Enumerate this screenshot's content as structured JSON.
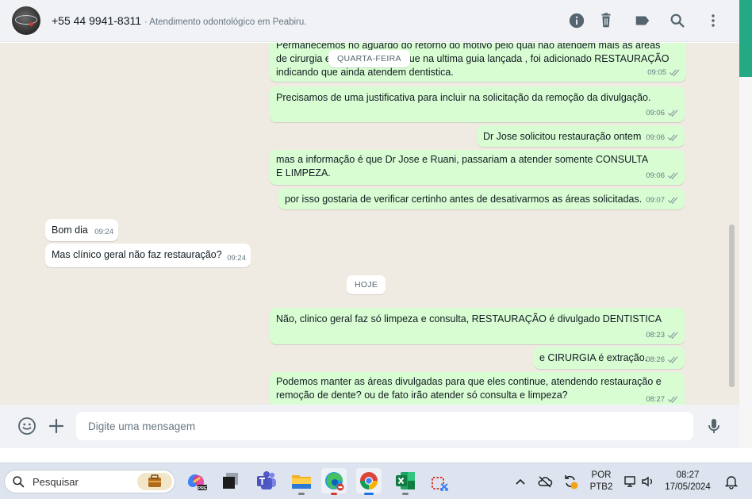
{
  "header": {
    "title": "+55 44 9941-8311",
    "subtitle": "· Atendimento odontológico em Peabiru.",
    "icons": [
      "info-icon",
      "trash-icon",
      "label-icon",
      "search-icon",
      "more-icon"
    ]
  },
  "messages": [
    {
      "type": "out",
      "line1": "Permanecemos no aguardo do retorno do motivo pelo qual não atendem mais as áreas",
      "line2": "de cirurgia e",
      "line2b": "que na ultima guia lançada , foi adicionado RESTAURAÇÃO",
      "line3": "indicando que ainda atendem dentistica.",
      "time": "09:05"
    },
    {
      "type": "out",
      "text": "Precisamos de uma justificativa para incluir na solicitação da remoção da divulgação.",
      "time": "09:06"
    },
    {
      "type": "out",
      "text": "Dr Jose solicitou restauração ontem",
      "time": "09:06"
    },
    {
      "type": "out",
      "text": "mas a informação é que Dr Jose e Ruani, passariam a atender somente CONSULTA E LIMPEZA.",
      "time": "09:06"
    },
    {
      "type": "out",
      "text": "por isso gostaria de verificar certinho antes de desativarmos as áreas solicitadas.",
      "time": "09:07"
    },
    {
      "type": "in",
      "text": "Bom dia",
      "time": "09:24"
    },
    {
      "type": "in",
      "text": "Mas clínico geral não faz restauração?",
      "time": "09:24"
    },
    {
      "type": "out",
      "text": "Não, clinico geral faz só limpeza e consulta, RESTAURAÇÃO é divulgado DENTISTICA",
      "time": "08:23"
    },
    {
      "type": "out",
      "text": "e CIRURGIA é extração.",
      "time": "08:26"
    },
    {
      "type": "out",
      "text": "Podemos manter as áreas divulgadas para que eles continue, atendendo restauração e remoção de dente? ou de fato irão atender só consulta e limpeza?",
      "time": "08:27"
    }
  ],
  "date_chips": {
    "previous": "QUARTA-FEIRA",
    "today": "HOJE"
  },
  "composer": {
    "placeholder": "Digite uma mensagem"
  },
  "taskbar": {
    "search_label": "Pesquisar",
    "apps": [
      "copilot-icon",
      "task-view-icon",
      "teams-icon",
      "file-explorer-icon",
      "edge-icon",
      "chrome-icon",
      "excel-icon",
      "snipping-tool-icon"
    ],
    "language": "POR",
    "layout": "PTB2",
    "time": "08:27",
    "date": "17/05/2024"
  },
  "colors": {
    "outgoing": "#d9fdd3",
    "incoming": "#ffffff",
    "chat_bg": "#efeae2",
    "accent": "#25a884"
  }
}
